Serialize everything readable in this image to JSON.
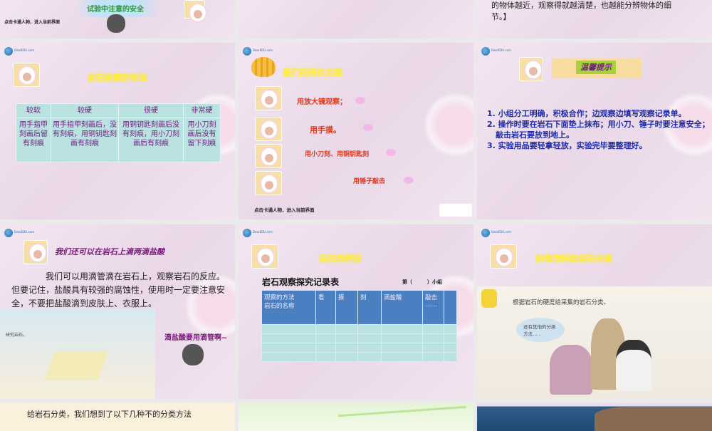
{
  "logo_text": "DearEDU.com",
  "slides": [
    {
      "title": "试验中注意的安全",
      "footer": "点击卡通人物，进入当前界面"
    },
    {},
    {
      "body": "的物体越近，观察得就越清楚，也越能分辨物体的细节。】"
    },
    {
      "title": "岩石硬度的标准",
      "table": {
        "headers": [
          "较软",
          "较硬",
          "很硬",
          "非常硬"
        ],
        "cells": [
          "用手指甲刻画后留有刻痕",
          "用手指甲刻画后，没有刻痕，用铜钥匙刻画有刻痕",
          "用铜钥匙刻画后没有刻痕，用小刀刻画后有刻痕",
          "用小刀刻画后没有留下刻痕"
        ]
      }
    },
    {
      "title": "我们的研究方案",
      "methods": [
        "用放大镜观察；",
        "用手摸。",
        "用小刀刻、用铜钥匙刻",
        "用锤子敲击"
      ],
      "footer": "点击卡通人物，进入当前界面"
    },
    {
      "title": "温馨提示",
      "tips": [
        "1. 小组分工明确，积极合作；边观察边填写观察记录单。",
        "2. 操作时要在岩石下面垫上抹布；用小刀、锤子时要注意安全；敲击岩石要放到地上。",
        "3. 实验用品要轻拿轻放，实验完毕要整理好。"
      ]
    },
    {
      "title": "我们还可以在岩石上滴两滴盐酸",
      "body": "我们可以用滴管滴在岩石上，观察岩石的反应。但要记住，盐酸具有较强的腐蚀性，使用时一定要注意安全，不要把盐酸滴到皮肤上、衣服上。",
      "caption": "滴盐酸要用滴管啊~",
      "image_label": "研究岩石。"
    },
    {
      "title": "岩石的特征",
      "table_title": "岩石观察探究记录表",
      "group_label": "第（　　　）小组",
      "headers": [
        "观察的方法\n岩石的名称",
        "看",
        "摸",
        "刻",
        "滴盐酸",
        "敲击\n……",
        ""
      ]
    },
    {
      "title": "你想怎样给岩石分类",
      "image_caption": "根据岩石的硬度给采集的岩石分类。",
      "bubble": "还有其他的分类方法……"
    },
    {
      "body": "给岩石分类，我们想到了以下几种不的分类方法"
    },
    {},
    {}
  ]
}
